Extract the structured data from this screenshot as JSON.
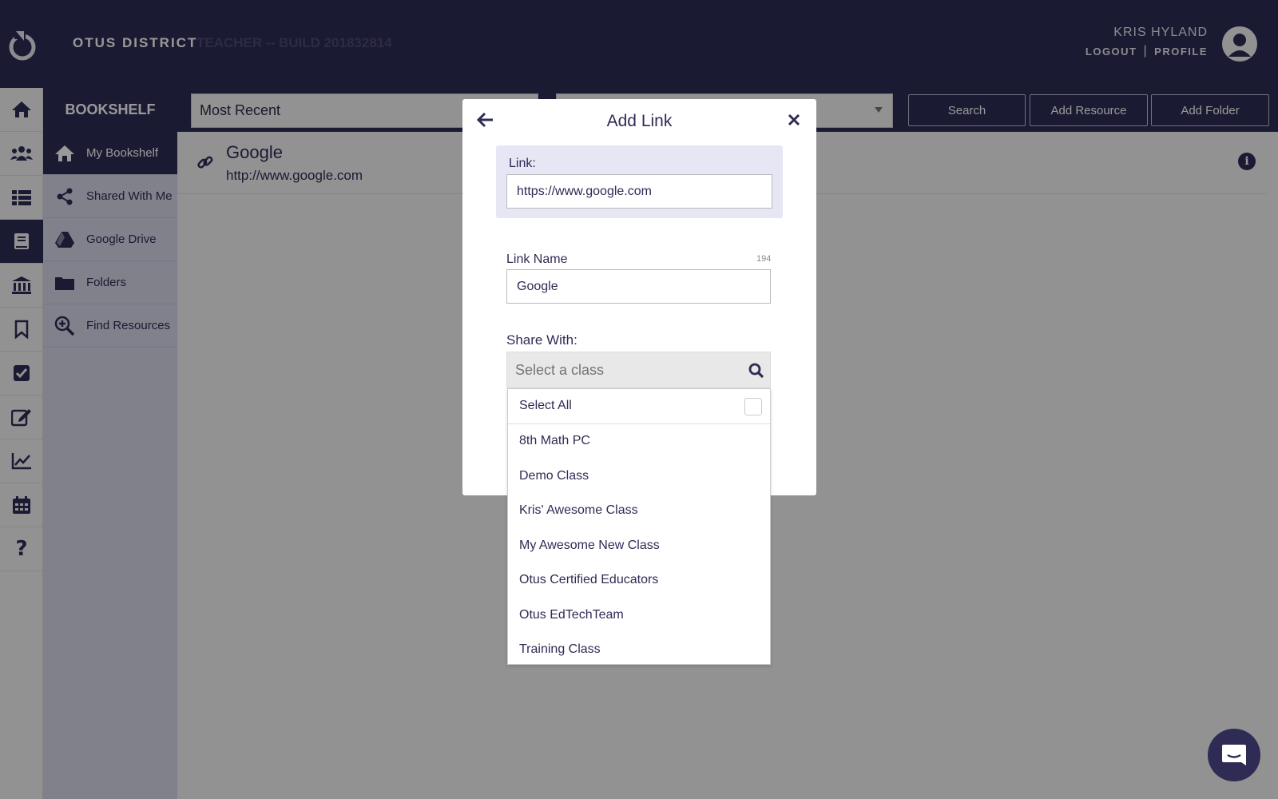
{
  "header": {
    "district": "OTUS DISTRICT",
    "build": "TEACHER -- BUILD 201832814",
    "user_name": "KRIS HYLAND",
    "logout": "LOGOUT",
    "separator": "|",
    "profile": "PROFILE"
  },
  "rail": {
    "icons": [
      "home-icon",
      "users-icon",
      "list-icon",
      "book-icon",
      "institution-icon",
      "bookmark-icon",
      "checkbox-icon",
      "edit-icon",
      "chart-icon",
      "calendar-icon",
      "help-icon"
    ],
    "active": "book-icon"
  },
  "shelf": {
    "title": "BOOKSHELF",
    "items": [
      {
        "label": "My Bookshelf",
        "icon": "home-icon"
      },
      {
        "label": "Shared With Me",
        "icon": "share-icon"
      },
      {
        "label": "Google Drive",
        "icon": "google-drive-icon"
      },
      {
        "label": "Folders",
        "icon": "folder-icon"
      },
      {
        "label": "Find Resources",
        "icon": "search-plus-icon"
      }
    ]
  },
  "toolbar": {
    "sort_value": "Most Recent",
    "search_label": "Search",
    "add_resource_label": "Add Resource",
    "add_folder_label": "Add Folder"
  },
  "resource": {
    "title": "Google",
    "url": "http://www.google.com"
  },
  "modal": {
    "title": "Add Link",
    "link_label": "Link:",
    "link_value": "https://www.google.com",
    "name_label": "Link Name",
    "name_count": "194",
    "name_value": "Google",
    "share_label": "Share With:",
    "class_placeholder": "Select a class",
    "select_all": "Select All",
    "classes": [
      "8th Math PC",
      "Demo Class",
      "Kris' Awesome Class",
      "My Awesome New Class",
      "Otus Certified Educators",
      "Otus EdTechTeam",
      "Training Class"
    ]
  },
  "colors": {
    "primary": "#2e2c55",
    "panel": "#e6e6f5",
    "nav_bg": "#d8d7ea"
  }
}
